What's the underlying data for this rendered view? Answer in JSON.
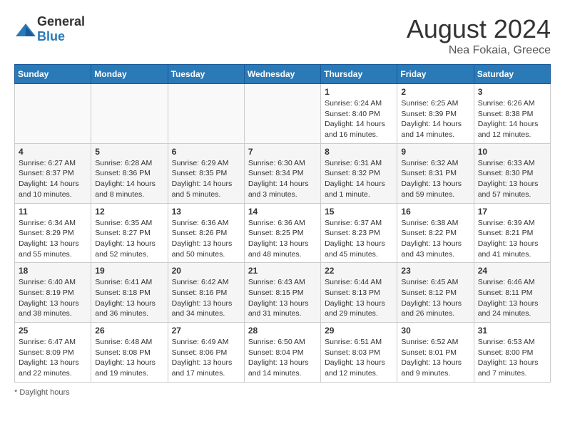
{
  "header": {
    "logo_general": "General",
    "logo_blue": "Blue",
    "month_title": "August 2024",
    "location": "Nea Fokaia, Greece"
  },
  "days_of_week": [
    "Sunday",
    "Monday",
    "Tuesday",
    "Wednesday",
    "Thursday",
    "Friday",
    "Saturday"
  ],
  "footer": {
    "note": "Daylight hours"
  },
  "weeks": [
    [
      {
        "day": "",
        "info": ""
      },
      {
        "day": "",
        "info": ""
      },
      {
        "day": "",
        "info": ""
      },
      {
        "day": "",
        "info": ""
      },
      {
        "day": "1",
        "info": "Sunrise: 6:24 AM\nSunset: 8:40 PM\nDaylight: 14 hours\nand 16 minutes."
      },
      {
        "day": "2",
        "info": "Sunrise: 6:25 AM\nSunset: 8:39 PM\nDaylight: 14 hours\nand 14 minutes."
      },
      {
        "day": "3",
        "info": "Sunrise: 6:26 AM\nSunset: 8:38 PM\nDaylight: 14 hours\nand 12 minutes."
      }
    ],
    [
      {
        "day": "4",
        "info": "Sunrise: 6:27 AM\nSunset: 8:37 PM\nDaylight: 14 hours\nand 10 minutes."
      },
      {
        "day": "5",
        "info": "Sunrise: 6:28 AM\nSunset: 8:36 PM\nDaylight: 14 hours\nand 8 minutes."
      },
      {
        "day": "6",
        "info": "Sunrise: 6:29 AM\nSunset: 8:35 PM\nDaylight: 14 hours\nand 5 minutes."
      },
      {
        "day": "7",
        "info": "Sunrise: 6:30 AM\nSunset: 8:34 PM\nDaylight: 14 hours\nand 3 minutes."
      },
      {
        "day": "8",
        "info": "Sunrise: 6:31 AM\nSunset: 8:32 PM\nDaylight: 14 hours\nand 1 minute."
      },
      {
        "day": "9",
        "info": "Sunrise: 6:32 AM\nSunset: 8:31 PM\nDaylight: 13 hours\nand 59 minutes."
      },
      {
        "day": "10",
        "info": "Sunrise: 6:33 AM\nSunset: 8:30 PM\nDaylight: 13 hours\nand 57 minutes."
      }
    ],
    [
      {
        "day": "11",
        "info": "Sunrise: 6:34 AM\nSunset: 8:29 PM\nDaylight: 13 hours\nand 55 minutes."
      },
      {
        "day": "12",
        "info": "Sunrise: 6:35 AM\nSunset: 8:27 PM\nDaylight: 13 hours\nand 52 minutes."
      },
      {
        "day": "13",
        "info": "Sunrise: 6:36 AM\nSunset: 8:26 PM\nDaylight: 13 hours\nand 50 minutes."
      },
      {
        "day": "14",
        "info": "Sunrise: 6:36 AM\nSunset: 8:25 PM\nDaylight: 13 hours\nand 48 minutes."
      },
      {
        "day": "15",
        "info": "Sunrise: 6:37 AM\nSunset: 8:23 PM\nDaylight: 13 hours\nand 45 minutes."
      },
      {
        "day": "16",
        "info": "Sunrise: 6:38 AM\nSunset: 8:22 PM\nDaylight: 13 hours\nand 43 minutes."
      },
      {
        "day": "17",
        "info": "Sunrise: 6:39 AM\nSunset: 8:21 PM\nDaylight: 13 hours\nand 41 minutes."
      }
    ],
    [
      {
        "day": "18",
        "info": "Sunrise: 6:40 AM\nSunset: 8:19 PM\nDaylight: 13 hours\nand 38 minutes."
      },
      {
        "day": "19",
        "info": "Sunrise: 6:41 AM\nSunset: 8:18 PM\nDaylight: 13 hours\nand 36 minutes."
      },
      {
        "day": "20",
        "info": "Sunrise: 6:42 AM\nSunset: 8:16 PM\nDaylight: 13 hours\nand 34 minutes."
      },
      {
        "day": "21",
        "info": "Sunrise: 6:43 AM\nSunset: 8:15 PM\nDaylight: 13 hours\nand 31 minutes."
      },
      {
        "day": "22",
        "info": "Sunrise: 6:44 AM\nSunset: 8:13 PM\nDaylight: 13 hours\nand 29 minutes."
      },
      {
        "day": "23",
        "info": "Sunrise: 6:45 AM\nSunset: 8:12 PM\nDaylight: 13 hours\nand 26 minutes."
      },
      {
        "day": "24",
        "info": "Sunrise: 6:46 AM\nSunset: 8:11 PM\nDaylight: 13 hours\nand 24 minutes."
      }
    ],
    [
      {
        "day": "25",
        "info": "Sunrise: 6:47 AM\nSunset: 8:09 PM\nDaylight: 13 hours\nand 22 minutes."
      },
      {
        "day": "26",
        "info": "Sunrise: 6:48 AM\nSunset: 8:08 PM\nDaylight: 13 hours\nand 19 minutes."
      },
      {
        "day": "27",
        "info": "Sunrise: 6:49 AM\nSunset: 8:06 PM\nDaylight: 13 hours\nand 17 minutes."
      },
      {
        "day": "28",
        "info": "Sunrise: 6:50 AM\nSunset: 8:04 PM\nDaylight: 13 hours\nand 14 minutes."
      },
      {
        "day": "29",
        "info": "Sunrise: 6:51 AM\nSunset: 8:03 PM\nDaylight: 13 hours\nand 12 minutes."
      },
      {
        "day": "30",
        "info": "Sunrise: 6:52 AM\nSunset: 8:01 PM\nDaylight: 13 hours\nand 9 minutes."
      },
      {
        "day": "31",
        "info": "Sunrise: 6:53 AM\nSunset: 8:00 PM\nDaylight: 13 hours\nand 7 minutes."
      }
    ]
  ]
}
